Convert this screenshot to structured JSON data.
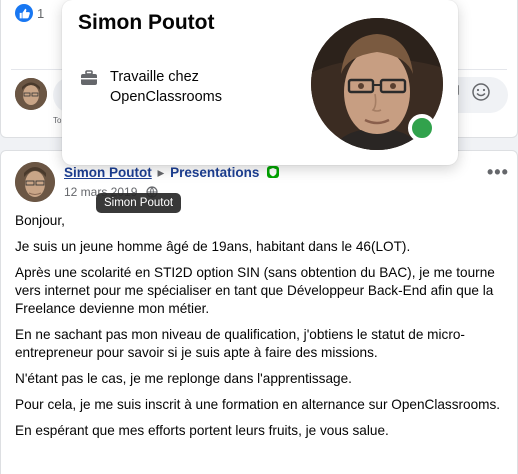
{
  "prev_post": {
    "like_count": "1",
    "peek_text": "r",
    "comment_label": "To"
  },
  "post": {
    "author": "Simon Poutot",
    "arrow": "▸",
    "group": "Presentations",
    "date": "12 mars 2019",
    "paragraphs": [
      "Bonjour,",
      "Je suis un jeune homme âgé de 19ans, habitant dans le 46(LOT).",
      "Après une scolarité en STI2D option SIN (sans obtention du BAC), je me tourne vers internet pour me spécialiser en tant que Développeur Back-End afin que la Freelance devienne mon métier.",
      "En ne sachant pas mon niveau de qualification, j'obtiens le statut de micro-entrepreneur pour savoir si je suis apte à faire des missions.",
      "N'étant pas le cas, je me replonge dans l'apprentissage.",
      "Pour cela, je me suis inscrit à une formation en alternance sur OpenClassrooms.",
      "En espérant que mes efforts portent leurs fruits, je vous salue."
    ]
  },
  "tooltip": {
    "text": "Simon Poutot"
  },
  "hovercard": {
    "name": "Simon Poutot",
    "work_line1": "Travaille chez",
    "work_line2": "OpenClassrooms",
    "online_color": "#31a24c"
  },
  "colors": {
    "link": "#1c3f94",
    "like_blue": "#1877f2",
    "badge_green": "#00a400"
  }
}
